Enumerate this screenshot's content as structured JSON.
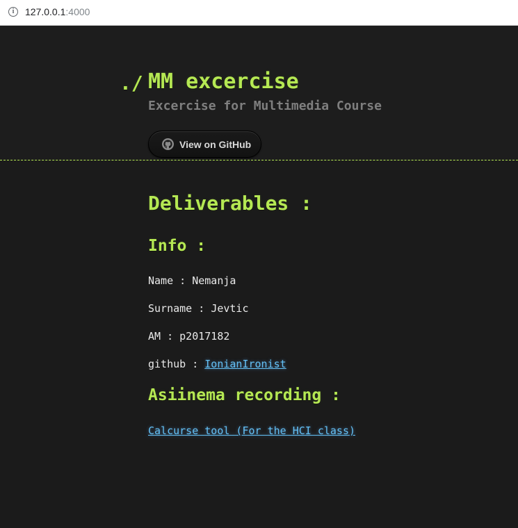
{
  "browser": {
    "url_host": "127.0.0.1",
    "url_port": ":4000"
  },
  "header": {
    "prompt": "./",
    "title": "MM excercise",
    "subtitle": "Excercise for Multimedia Course",
    "github_button_label": "View on GitHub",
    "github_icon": "github-octocat-icon"
  },
  "main": {
    "heading": "Deliverables :",
    "info_heading": "Info :",
    "info": [
      {
        "key": "Name : ",
        "value": "Nemanja"
      },
      {
        "key": "Surname : ",
        "value": "Jevtic"
      },
      {
        "key": "AM : ",
        "value": "p2017182"
      }
    ],
    "github_key": "github : ",
    "github_user": "IonianIronist",
    "recording_heading": "Asiinema recording :",
    "recording_link": "Calcurse tool (For the HCI class)"
  },
  "colors": {
    "accent": "#b5e853",
    "link": "#63c0f5",
    "background": "#1b1b1b",
    "text": "#eaeaea",
    "subtitle": "#7f7f7f"
  }
}
